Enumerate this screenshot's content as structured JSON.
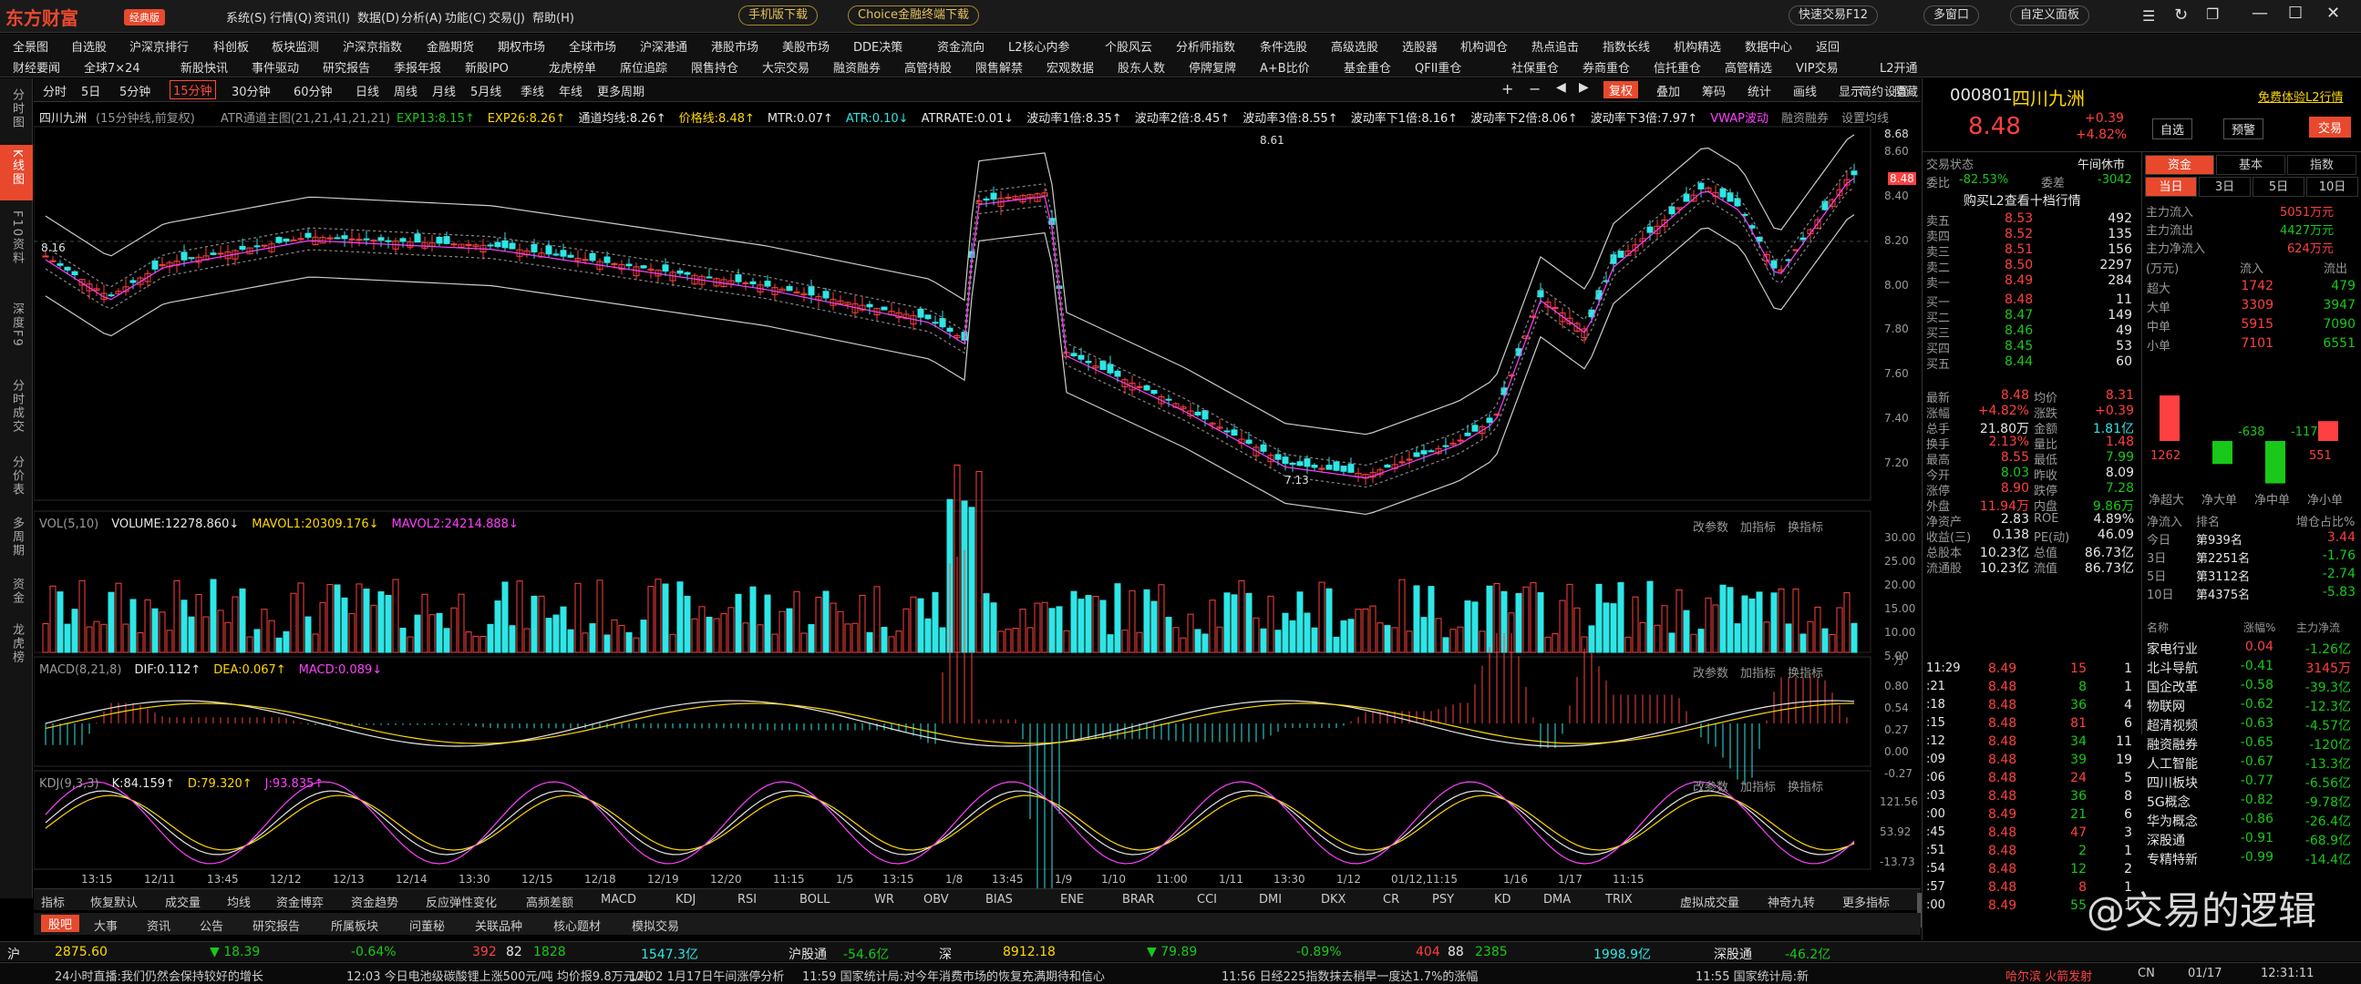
{
  "app": {
    "logo": "东方财富",
    "edition": "经典版",
    "menus": [
      "系统(S)",
      "行情(Q)",
      "资讯(I)",
      "数据(D)",
      "分析(A)",
      "功能(C)",
      "交易(J)",
      "帮助(H)"
    ],
    "mobile_download": "手机版下载",
    "choice_download": "Choice金融终端下载",
    "quick_trade": "快速交易F12",
    "multi_window": "多窗口",
    "custom_layout": "自定义面板"
  },
  "nav": {
    "row1": [
      "全景图",
      "自选股",
      "沪深京排行",
      "科创板",
      "板块监测",
      "沪深京指数",
      "金融期货",
      "期权市场",
      "全球市场",
      "沪深港通",
      "港股市场",
      "美股市场",
      "DDE决策",
      "资金流向",
      "L2核心内参",
      "个股风云",
      "分析师指数",
      "条件选股",
      "高级选股",
      "选股器",
      "机构调仓",
      "热点追击",
      "指数长线",
      "机构精选",
      "数据中心",
      "返回"
    ],
    "row2": [
      "财经要闻",
      "全球7×24",
      "新股快讯",
      "事件驱动",
      "研究报告",
      "季报年报",
      "新股IPO",
      "龙虎榜单",
      "席位追踪",
      "限售持仓",
      "大宗交易",
      "融资融券",
      "高管持股",
      "限售解禁",
      "宏观数据",
      "股东人数",
      "停牌复牌",
      "A+B比价",
      "基金重仓",
      "QFII重仓",
      "社保重仓",
      "券商重仓",
      "信托重仓",
      "高管精选",
      "VIP交易",
      "L2开通"
    ]
  },
  "leftbar": [
    {
      "label": "分时图",
      "active": false
    },
    {
      "label": "K线图",
      "active": true
    },
    {
      "label": "F10资料",
      "active": false
    },
    {
      "label": "深度F9",
      "active": false
    },
    {
      "label": "分时成交",
      "active": false
    },
    {
      "label": "分价表",
      "active": false
    },
    {
      "label": "多周期",
      "active": false
    },
    {
      "label": "资金",
      "active": false
    },
    {
      "label": "龙虎榜",
      "active": false
    }
  ],
  "periods": [
    "分时",
    "5日",
    "5分钟",
    "15分钟",
    "30分钟",
    "60分钟",
    "日线",
    "周线",
    "月线",
    "5月线",
    "季线",
    "年线",
    "更多周期"
  ],
  "active_period": "15分钟",
  "chart_tools": {
    "restore": "复权",
    "overlay": "叠加",
    "bid": "筹码",
    "stats": "统计",
    "draw": "画线",
    "display": "显示",
    "settings": "设置",
    "simplify": "简约",
    "hide": "隐藏"
  },
  "indicators": {
    "main": "四川九洲",
    "main_note": "(15分钟线,前复权)",
    "atr_band": "ATR通道主图(21,21,41,21,21)",
    "items": [
      {
        "t": "EXP13:8.15↑",
        "c": "#19c819"
      },
      {
        "t": "EXP26:8.26↑",
        "c": "#ffd700"
      },
      {
        "t": "通道均线:8.26↑",
        "c": "#e6e6e6"
      },
      {
        "t": "价格线:8.48↑",
        "c": "#ffd700"
      },
      {
        "t": "MTR:0.07↑",
        "c": "#e6e6e6"
      },
      {
        "t": "ATR:0.10↓",
        "c": "#2ee6e6"
      },
      {
        "t": "ATRRATE:0.01↓",
        "c": "#e6e6e6"
      },
      {
        "t": "波动率1倍:8.35↑",
        "c": "#e6e6e6"
      },
      {
        "t": "波动率2倍:8.45↑",
        "c": "#e6e6e6"
      },
      {
        "t": "波动率3倍:8.55↑",
        "c": "#e6e6e6"
      },
      {
        "t": "波动率下1倍:8.16↑",
        "c": "#e6e6e6"
      },
      {
        "t": "波动率下2倍:8.06↑",
        "c": "#e6e6e6"
      },
      {
        "t": "波动率下3倍:7.97↑",
        "c": "#e6e6e6"
      },
      {
        "t": "VWAP波动",
        "c": "#ff40ff"
      },
      {
        "t": "融资融券",
        "c": "#999"
      },
      {
        "t": "设置均线",
        "c": "#999"
      }
    ],
    "vol": [
      {
        "t": "VOL(5,10)",
        "c": "#999"
      },
      {
        "t": "VOLUME:12278.860↓",
        "c": "#e6e6e6"
      },
      {
        "t": "MAVOL1:20309.176↓",
        "c": "#ffd700"
      },
      {
        "t": "MAVOL2:24214.888↓",
        "c": "#ff40ff"
      }
    ],
    "macd": [
      {
        "t": "MACD(8,21,8)",
        "c": "#999"
      },
      {
        "t": "DIF:0.112↑",
        "c": "#e6e6e6"
      },
      {
        "t": "DEA:0.067↑",
        "c": "#ffd700"
      },
      {
        "t": "MACD:0.089↓",
        "c": "#ff40ff"
      }
    ],
    "kdj": [
      {
        "t": "KDJ(9,3,3)",
        "c": "#999"
      },
      {
        "t": "K:84.159↑",
        "c": "#e6e6e6"
      },
      {
        "t": "D:79.320↑",
        "c": "#ffd700"
      },
      {
        "t": "J:93.835↑",
        "c": "#ff40ff"
      }
    ],
    "sub_tools": [
      "改参数",
      "加指标",
      "换指标"
    ]
  },
  "price_axis": [
    "8.60",
    "8.40",
    "8.20",
    "8.00",
    "7.80",
    "7.60",
    "7.40",
    "7.20"
  ],
  "price_marks": {
    "high": "8.61",
    "low": "7.13",
    "first": "8.16",
    "last": "8.48",
    "top": "8.68"
  },
  "vol_axis": [
    "30.00",
    "25.00",
    "20.00",
    "15.00",
    "10.00",
    "5.00"
  ],
  "vol_unit": "万",
  "macd_axis": [
    "0.80",
    "0.54",
    "0.27",
    "0.00",
    "-0.27"
  ],
  "kdj_axis": [
    "121.56",
    "53.92",
    "-13.73"
  ],
  "time_axis": [
    "13:15",
    "12/11",
    "13:45",
    "12/12",
    "12/13",
    "12/14",
    "13:30",
    "12/15",
    "12/18",
    "12/19",
    "12/20",
    "11:15",
    "1/5",
    "13:15",
    "1/8",
    "13:45",
    "1/9",
    "1/10",
    "11:00",
    "1/11",
    "13:30",
    "1/12",
    "01/12,11:15",
    "1/16",
    "1/17",
    "11:15"
  ],
  "bottom_tabs": [
    "指标",
    "恢复默认",
    "成交量",
    "均线",
    "资金博弈",
    "资金趋势",
    "反应弹性变化",
    "高频差额",
    "MACD",
    "KDJ",
    "RSI",
    "BOLL",
    "WR",
    "OBV",
    "BIAS",
    "ENE",
    "BRAR",
    "CCI",
    "DMI",
    "DKX",
    "CR",
    "PSY",
    "KD",
    "DMA",
    "TRIX",
    "虚拟成交量",
    "神奇九转",
    "更多指标",
    "模板"
  ],
  "news_tabs": [
    "股吧",
    "大事",
    "资讯",
    "公告",
    "研究报告",
    "所属板块",
    "问董秘",
    "关联品种",
    "核心题材",
    "模拟交易"
  ],
  "indices": [
    {
      "name": "沪",
      "val": "2875.60",
      "chg": "▼ 18.39",
      "pct": "-0.64%",
      "up": "392",
      "flat": "82",
      "down": "1828",
      "amt": "1547.3亿"
    },
    {
      "name": "沪股通",
      "val": "-54.6亿"
    },
    {
      "name": "深",
      "val": "8912.18",
      "chg": "▼ 79.89",
      "pct": "-0.89%",
      "up": "404",
      "flat": "88",
      "down": "2385",
      "amt": "1998.9亿"
    },
    {
      "name": "深股通",
      "val": "-46.2亿"
    }
  ],
  "ticker": [
    "24小时直播:我们仍然会保持较好的增长",
    "12:03 今日电池级碳酸锂上涨500元/吨 均价报9.8万元/吨",
    "12:02 1月17日午间涨停分析",
    "11:59 国家统计局:对今年消费市场的恢复充满期待和信心",
    "11:56 日经225指数抹去稍早一度达1.7%的涨幅",
    "11:55 国家统计局:新",
    "哈尔滨 火箭发射",
    "CN",
    "01/17",
    "12:31:11"
  ],
  "quote": {
    "code": "000801",
    "name": "四川九洲",
    "price": "8.48",
    "chg": "+0.39",
    "pct": "+4.82%",
    "l2_link": "免费体验L2行情",
    "self_select": "自选",
    "warn": "预警",
    "trade": "交易",
    "status_label": "交易状态",
    "status": "午间休市",
    "weibi_label": "委比",
    "weibi": "-82.53%",
    "weicha_label": "委差",
    "weicha": "-3042",
    "buy_l2": "购买L2查看十档行情",
    "asks": [
      {
        "l": "卖五",
        "p": "8.53",
        "v": "492"
      },
      {
        "l": "卖四",
        "p": "8.52",
        "v": "135"
      },
      {
        "l": "卖三",
        "p": "8.51",
        "v": "156"
      },
      {
        "l": "卖二",
        "p": "8.50",
        "v": "2297"
      },
      {
        "l": "卖一",
        "p": "8.49",
        "v": "284"
      }
    ],
    "bids": [
      {
        "l": "买一",
        "p": "8.48",
        "v": "11"
      },
      {
        "l": "买二",
        "p": "8.47",
        "v": "149"
      },
      {
        "l": "买三",
        "p": "8.46",
        "v": "49"
      },
      {
        "l": "买四",
        "p": "8.45",
        "v": "53"
      },
      {
        "l": "买五",
        "p": "8.44",
        "v": "60"
      }
    ],
    "stats": [
      [
        "最新",
        "8.48",
        "red",
        "均价",
        "8.31",
        "red"
      ],
      [
        "涨幅",
        "+4.82%",
        "red",
        "涨跌",
        "+0.39",
        "red"
      ],
      [
        "总手",
        "21.80万",
        "wht",
        "金额",
        "1.81亿",
        "cy"
      ],
      [
        "换手",
        "2.13%",
        "red",
        "量比",
        "1.48",
        "red"
      ],
      [
        "最高",
        "8.55",
        "red",
        "最低",
        "7.99",
        "grn"
      ],
      [
        "今开",
        "8.03",
        "grn",
        "昨收",
        "8.09",
        "wht"
      ],
      [
        "涨停",
        "8.90",
        "red",
        "跌停",
        "7.28",
        "grn"
      ],
      [
        "外盘",
        "11.94万",
        "red",
        "内盘",
        "9.86万",
        "grn"
      ],
      [
        "净资产",
        "2.83",
        "wht",
        "ROE",
        "4.89%",
        "wht"
      ],
      [
        "收益(三)",
        "0.138",
        "wht",
        "PE(动)",
        "46.09",
        "wht"
      ],
      [
        "总股本",
        "10.23亿",
        "wht",
        "总值",
        "86.73亿",
        "wht"
      ],
      [
        "流通股",
        "10.23亿",
        "wht",
        "流值",
        "86.73亿",
        "wht"
      ]
    ],
    "trades": [
      [
        "11:29",
        "8.49",
        "15",
        "1"
      ],
      [
        ":21",
        "8.48",
        "8",
        "1"
      ],
      [
        ":18",
        "8.48",
        "36",
        "4"
      ],
      [
        ":15",
        "8.48",
        "81",
        "6"
      ],
      [
        ":12",
        "8.48",
        "34",
        "11"
      ],
      [
        ":09",
        "8.48",
        "39",
        "19"
      ],
      [
        ":06",
        "8.48",
        "24",
        "5"
      ],
      [
        ":03",
        "8.48",
        "36",
        "8"
      ],
      [
        ":00",
        "8.49",
        "21",
        "6"
      ],
      [
        ":45",
        "8.48",
        "47",
        "3"
      ],
      [
        ":51",
        "8.48",
        "2",
        "1"
      ],
      [
        ":54",
        "8.48",
        "12",
        "2"
      ],
      [
        ":57",
        "8.48",
        "8",
        "1"
      ],
      [
        ":00",
        "8.49",
        "55",
        "1"
      ]
    ]
  },
  "capital": {
    "tabs": [
      "资金",
      "基本",
      "指数"
    ],
    "periods": [
      "当日",
      "3日",
      "5日",
      "10日"
    ],
    "main_in_label": "主力流入",
    "main_in": "5051万元",
    "main_out_label": "主力流出",
    "main_out": "4427万元",
    "main_net_label": "主力净流入",
    "main_net": "624万元",
    "unit": "(万元)",
    "in_label": "流入",
    "out_label": "流出",
    "rows": [
      [
        "超大",
        "1742",
        "479"
      ],
      [
        "大单",
        "3309",
        "3947"
      ],
      [
        "中单",
        "5915",
        "7090"
      ],
      [
        "小单",
        "7101",
        "6551"
      ]
    ],
    "bars": [
      {
        "label": "净超大",
        "value": 1262
      },
      {
        "label": "净大单",
        "value": -638
      },
      {
        "label": "净中单",
        "value": -1175
      },
      {
        "label": "净小单",
        "value": 551
      }
    ],
    "rank_head": [
      "净流入",
      "排名",
      "增仓占比%"
    ],
    "rank": [
      [
        "今日",
        "第939名",
        "3.44",
        "red"
      ],
      [
        "3日",
        "第2251名",
        "-1.76",
        "grn"
      ],
      [
        "5日",
        "第3112名",
        "-2.74",
        "grn"
      ],
      [
        "10日",
        "第4375名",
        "-5.83",
        "grn"
      ]
    ]
  },
  "sectors": {
    "head": [
      "名称",
      "涨幅%",
      "主力净流"
    ],
    "rows": [
      [
        "家电行业",
        "0.04",
        "-1.26亿"
      ],
      [
        "北斗导航",
        "-0.41",
        "3145万"
      ],
      [
        "国企改革",
        "-0.58",
        "-39.3亿"
      ],
      [
        "物联网",
        "-0.62",
        "-12.3亿"
      ],
      [
        "超清视频",
        "-0.63",
        "-4.57亿"
      ],
      [
        "融资融券",
        "-0.65",
        "-120亿"
      ],
      [
        "人工智能",
        "-0.67",
        "-13.3亿"
      ],
      [
        "四川板块",
        "-0.77",
        "-6.56亿"
      ],
      [
        "5G概念",
        "-0.82",
        "-9.78亿"
      ],
      [
        "华为概念",
        "-0.86",
        "-26.4亿"
      ],
      [
        "深股通",
        "-0.91",
        "-68.9亿"
      ],
      [
        "专精特新",
        "-0.99",
        "-14.4亿"
      ]
    ]
  },
  "watermark": "@交易的逻辑"
}
